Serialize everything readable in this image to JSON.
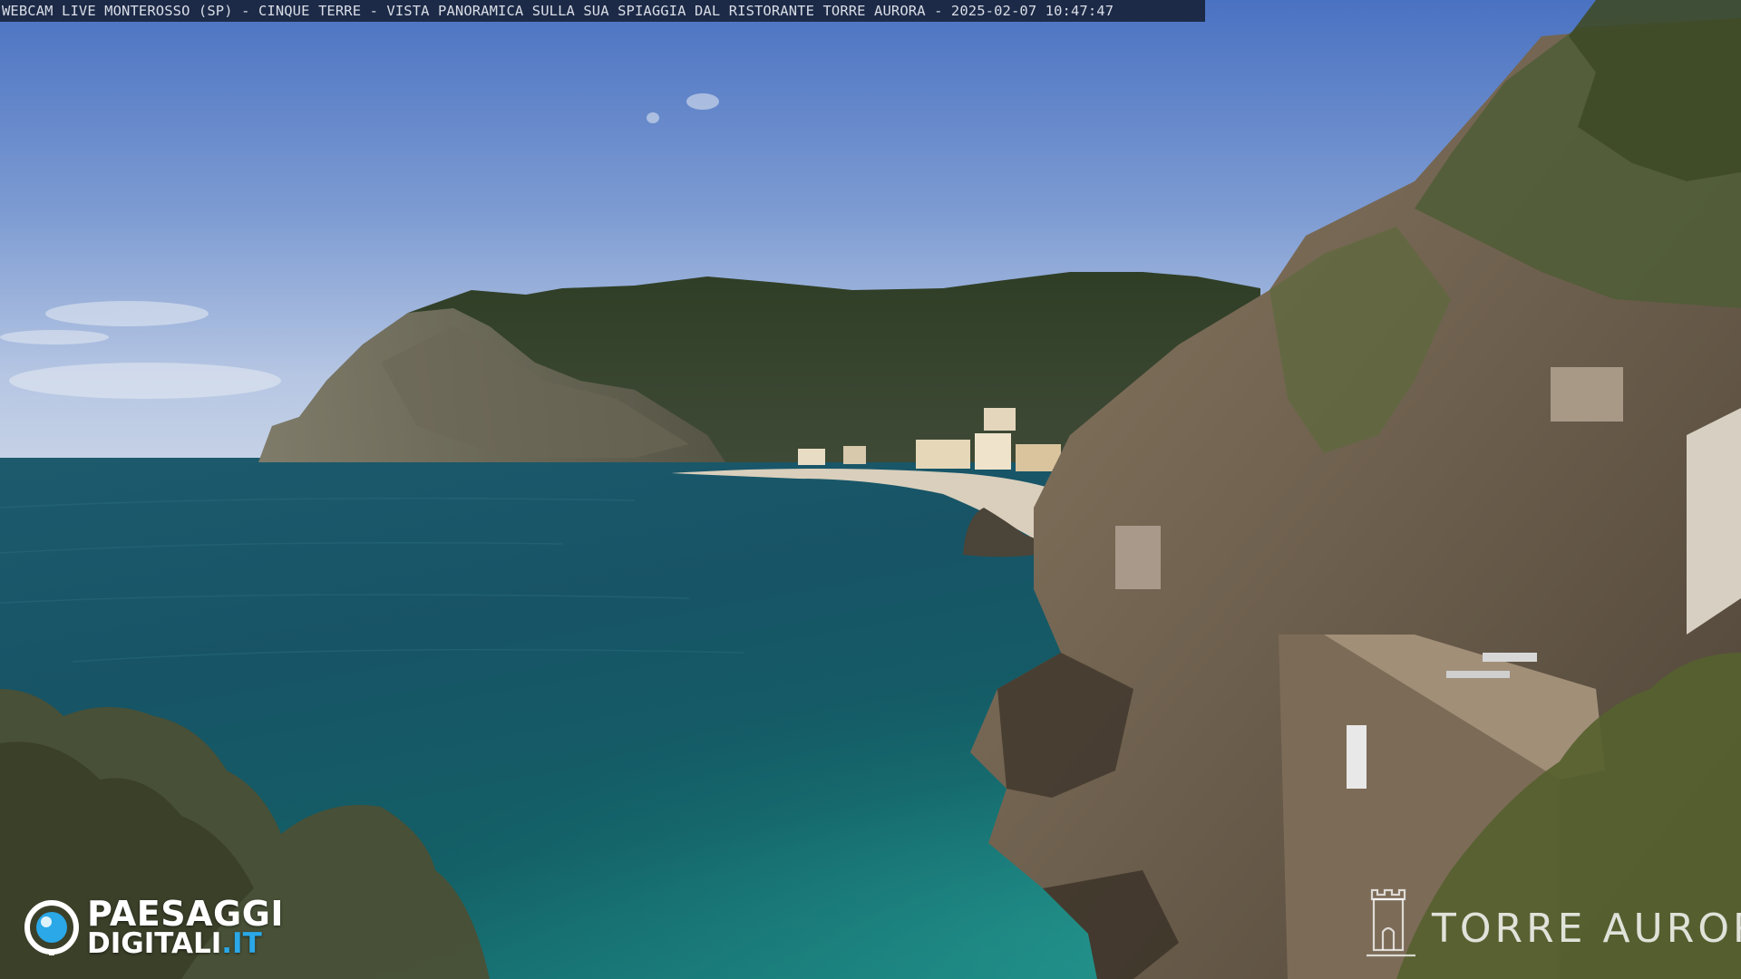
{
  "caption": {
    "text": "WEBCAM LIVE MONTEROSSO (SP) - CINQUE TERRE - VISTA PANORAMICA SULLA SUA SPIAGGIA DAL RISTORANTE TORRE AURORA - 2025-02-07 10:47:47"
  },
  "logo": {
    "word1": "PAESAGGI",
    "word2": "DIGITALI",
    "tld": ".IT",
    "icon": "camera-lens-icon",
    "accent": "#2aa8e8"
  },
  "brand": {
    "name": "TORRE AURORA",
    "icon": "tower-icon"
  },
  "colors": {
    "sky_top": "#4a72c2",
    "sky_horizon": "#c7d3e6",
    "sea_deep": "#0d3d4e",
    "sea_shallow": "#1c8d8a"
  }
}
